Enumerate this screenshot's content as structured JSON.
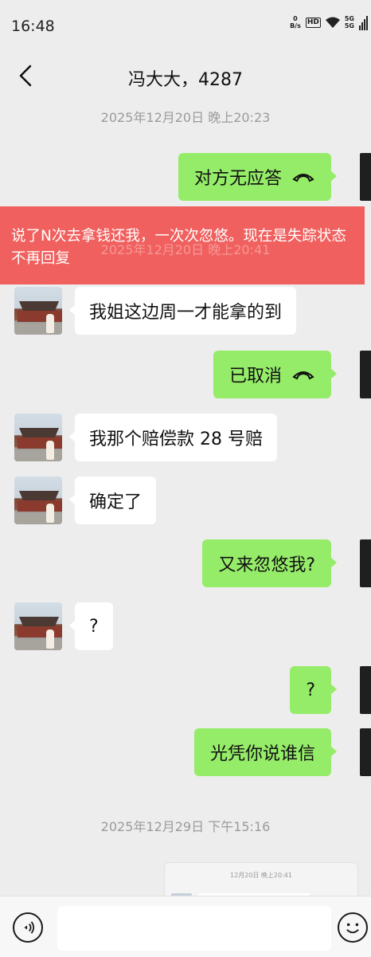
{
  "status_bar": {
    "time": "16:48",
    "net_speed_value": "0",
    "net_speed_unit": "B/s",
    "hd_label": "HD",
    "sig1": "5G",
    "sig2": "5G"
  },
  "header": {
    "title": "冯大大，4287"
  },
  "timestamps": {
    "t1": "2025年12月20日 晚上20:23",
    "t_ghost": "2025年12月20日 晚上20:41",
    "t2": "2025年12月29日 下午15:16"
  },
  "warning": {
    "text": "说了N次去拿钱还我，一次次忽悠。现在是失踪状态不再回复"
  },
  "messages": [
    {
      "side": "out",
      "text": "对方无应答",
      "call": true
    },
    {
      "side": "in",
      "text": "我姐这边周一才能拿的到"
    },
    {
      "side": "out",
      "text": "已取消",
      "call": true
    },
    {
      "side": "in",
      "text": "我那个赔偿款 28 号赔"
    },
    {
      "side": "in",
      "text": "确定了"
    },
    {
      "side": "out",
      "text": "又来忽悠我?"
    },
    {
      "side": "in",
      "text": "?"
    },
    {
      "side": "out",
      "text": "?"
    },
    {
      "side": "out",
      "text": "光凭你说谁信"
    }
  ],
  "forward_card": {
    "timestamp": "12月20日 晚上20:41"
  },
  "colors": {
    "outgoing": "#95ec69",
    "incoming": "#ffffff",
    "warning": "#f0605e",
    "background": "#ededed"
  },
  "icons": [
    "back-arrow-icon",
    "call-end-icon",
    "voice-icon",
    "emoji-icon",
    "wifi-icon"
  ]
}
